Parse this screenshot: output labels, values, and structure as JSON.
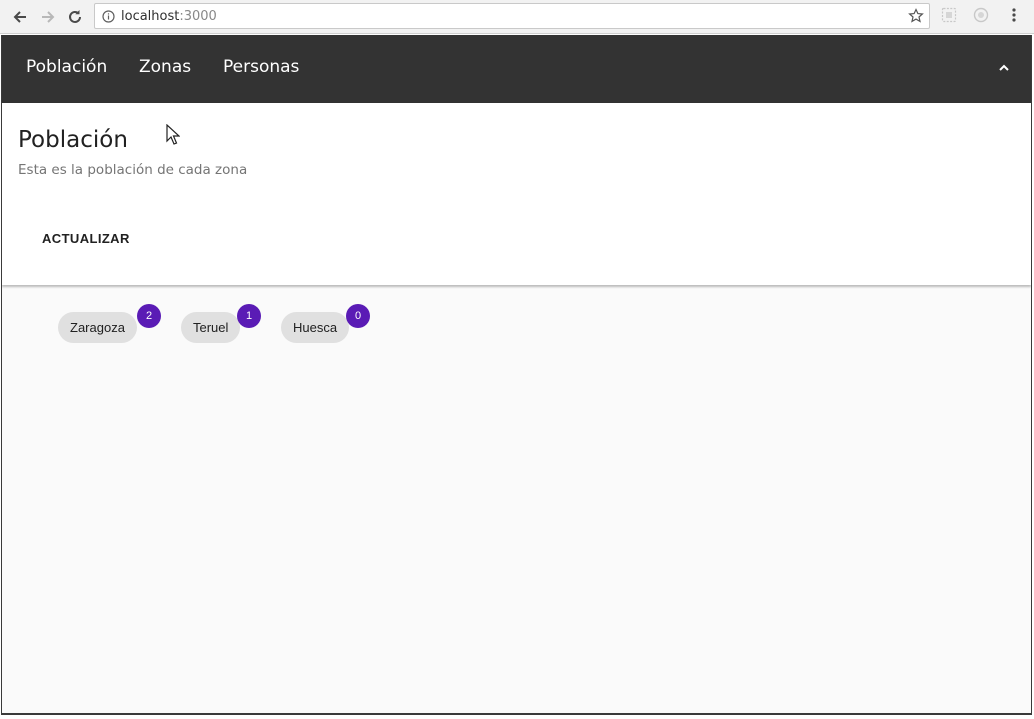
{
  "browser": {
    "url_host": "localhost",
    "url_port": ":3000"
  },
  "navbar": {
    "links": [
      {
        "label": "Población"
      },
      {
        "label": "Zonas"
      },
      {
        "label": "Personas"
      }
    ]
  },
  "card": {
    "title": "Población",
    "subtitle": "Esta es la población de cada zona",
    "update_label": "ACTUALIZAR"
  },
  "zones": [
    {
      "name": "Zaragoza",
      "count": "2"
    },
    {
      "name": "Teruel",
      "count": "1"
    },
    {
      "name": "Huesca",
      "count": "0"
    }
  ],
  "colors": {
    "navbar_bg": "#333333",
    "badge_bg": "#5a1bb5",
    "chip_bg": "#e0e0e0"
  }
}
